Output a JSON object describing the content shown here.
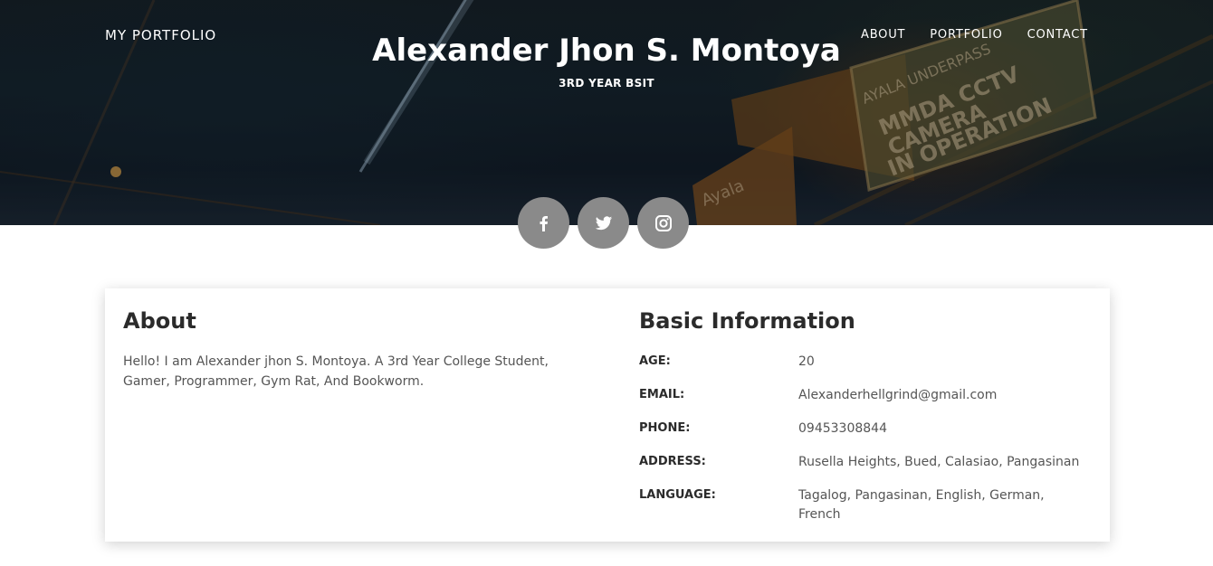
{
  "nav": {
    "brand": "MY PORTFOLIO",
    "links": [
      "ABOUT",
      "PORTFOLIO",
      "CONTACT"
    ]
  },
  "hero": {
    "title": "Alexander Jhon S. Montoya",
    "subtitle": "3RD YEAR BSIT",
    "sign_text": [
      "AYALA UNDERPASS",
      "MMDA CCTV",
      "CAMERA",
      "IN OPERATION",
      "Ayala"
    ]
  },
  "social": {
    "icons": [
      "facebook-icon",
      "twitter-icon",
      "instagram-icon"
    ],
    "button_color": "#8a8a8a"
  },
  "about": {
    "heading": "About",
    "text": "Hello! I am Alexander jhon S. Montoya. A 3rd Year College Student, Gamer, Programmer, Gym Rat, And Bookworm."
  },
  "basic": {
    "heading": "Basic Information",
    "rows": [
      {
        "label": "AGE:",
        "value": "20"
      },
      {
        "label": "EMAIL:",
        "value": "Alexanderhellgrind@gmail.com"
      },
      {
        "label": "PHONE:",
        "value": "09453308844"
      },
      {
        "label": "ADDRESS:",
        "value": "Rusella Heights, Bued, Calasiao, Pangasinan"
      },
      {
        "label": "LANGUAGE:",
        "value": "Tagalog, Pangasinan, English, German, French"
      }
    ]
  }
}
